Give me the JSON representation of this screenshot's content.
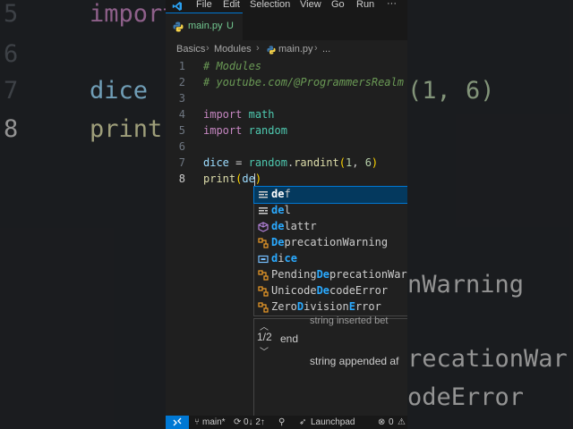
{
  "background_code": {
    "lines": [
      {
        "number": "5",
        "text": "import"
      },
      {
        "number": "6",
        "text": ""
      },
      {
        "number": "7",
        "text": "dice",
        "tail": "(1, 6)"
      },
      {
        "number": "8",
        "text": "print"
      }
    ],
    "right_fragments": [
      "nWarning",
      "recationWar",
      "odeError"
    ]
  },
  "menubar": {
    "items": [
      "File",
      "Edit",
      "Selection",
      "View",
      "Go",
      "Run"
    ],
    "more": "···"
  },
  "tab": {
    "label": "main.py",
    "badge": "U"
  },
  "breadcrumb": {
    "items": [
      "Basics",
      "Modules",
      "main.py",
      "..."
    ]
  },
  "editor": {
    "line_numbers": [
      "1",
      "2",
      "3",
      "4",
      "5",
      "6",
      "7",
      "8"
    ],
    "active_line": "8",
    "code": {
      "l1": "# Modules",
      "l2": "# youtube.com/@ProgrammersRealm",
      "l4_kw": "import",
      "l4_mod": "math",
      "l5_kw": "import",
      "l5_mod": "random",
      "l7_var": "dice",
      "l7_op": " = ",
      "l7_mod": "random",
      "l7_dot": ".",
      "l7_fn": "randint",
      "l7_open": "(",
      "l7_n1": "1",
      "l7_comma": ", ",
      "l7_n2": "6",
      "l7_close": ")",
      "l8_fn": "print",
      "l8_open": "(",
      "l8_typed": "de",
      "l8_close": ")"
    }
  },
  "suggestions": [
    {
      "hl1": "de",
      "rest": "f",
      "kind": "keyword-icon"
    },
    {
      "hl1": "de",
      "rest": "l",
      "kind": "keyword-icon"
    },
    {
      "hl1": "de",
      "rest": "lattr",
      "kind": "method-icon"
    },
    {
      "hl1": "De",
      "rest": "precationWarning",
      "kind": "class-icon"
    },
    {
      "hl1": "d",
      "mid": "i",
      "hl2": "ce",
      "rest": "",
      "kind": "variable-icon"
    },
    {
      "pre": "Pending",
      "hl1": "De",
      "rest": "precationWar",
      "kind": "class-icon"
    },
    {
      "pre": "Unicode",
      "hl1": "De",
      "rest": "codeError",
      "kind": "class-icon"
    },
    {
      "pre": "Zero",
      "hl1": "D",
      "mid": "ivision",
      "hl2": "E",
      "rest": "rror",
      "kind": "class-icon"
    }
  ],
  "hint": {
    "top_text": "string inserted bet",
    "end_label": "end",
    "string_text": "string appended af",
    "page": "1/2",
    "up": "︿",
    "down": "﹀"
  },
  "statusbar": {
    "branch": "main*",
    "sync": "0↓ 2↑",
    "launchpad": "Launchpad",
    "errors": "0"
  },
  "colors": {
    "accent": "#0078d4",
    "comment": "#6a9955",
    "keyword": "#c586c0",
    "module": "#4ec9b0",
    "function": "#dcdcaa",
    "number": "#b5cea8",
    "variable": "#9cdcfe",
    "bracket": "#ffd700",
    "match_highlight": "#2aaaff"
  }
}
